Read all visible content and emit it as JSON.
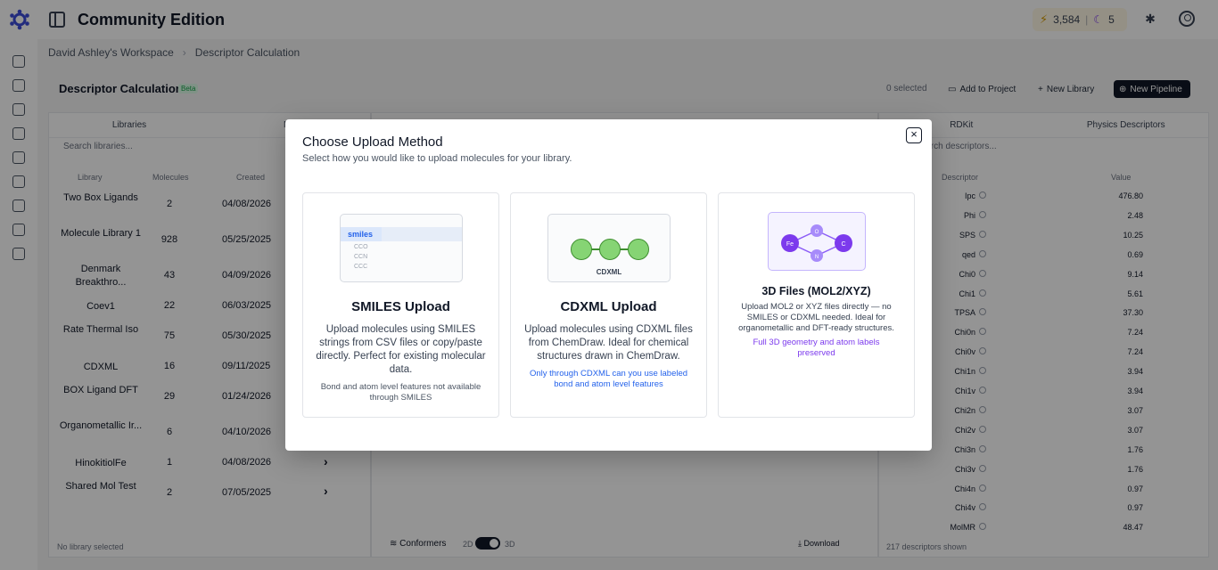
{
  "app": {
    "title": "Community Edition",
    "credits": "3,584",
    "separator": "|",
    "moon_count": "5"
  },
  "breadcrumb": {
    "workspace": "David Ashley's Workspace",
    "page": "Descriptor Calculation",
    "chevron": "›"
  },
  "header": {
    "title": "Descriptor Calculation",
    "badge": "Beta",
    "selected": "0 selected",
    "add_to_project": "Add to Project",
    "new_library": "New Library",
    "new_pipeline": "New Pipeline"
  },
  "left_panel": {
    "tab_libraries": "Libraries",
    "tab_molecules": "Mo",
    "search_placeholder": "Search libraries...",
    "columns": {
      "library": "Library",
      "molecules": "Molecules",
      "created": "Created"
    },
    "rows": [
      {
        "name": "Two Box Ligands",
        "count": "2",
        "date": "04/08/2026"
      },
      {
        "name": "Molecule Library 1",
        "count": "928",
        "date": "05/25/2025"
      },
      {
        "name": "Denmark Breakthro...",
        "count": "43",
        "date": "04/09/2026"
      },
      {
        "name": "Coev1",
        "count": "22",
        "date": "06/03/2025"
      },
      {
        "name": "Rate Thermal Iso",
        "count": "75",
        "date": "05/30/2025"
      },
      {
        "name": "CDXML",
        "count": "16",
        "date": "09/11/2025"
      },
      {
        "name": "BOX Ligand DFT",
        "count": "29",
        "date": "01/24/2026"
      },
      {
        "name": "Organometallic Ir...",
        "count": "6",
        "date": "04/10/2026"
      },
      {
        "name": "HinokitiolFe",
        "count": "1",
        "date": "04/08/2026",
        "arrow": "›"
      },
      {
        "name": "Shared Mol Test",
        "count": "2",
        "date": "07/05/2025",
        "arrow": "›"
      }
    ],
    "footer": "No library selected"
  },
  "middle_panel": {
    "conformers_label": "Conformers",
    "toggle_2d": "2D",
    "toggle_3d": "3D",
    "download_label": "Download"
  },
  "right_panel": {
    "tab_rdkit": "RDKit",
    "tab_physics": "Physics Descriptors",
    "search_placeholder": "Search descriptors...",
    "col_descriptor": "Descriptor",
    "col_value": "Value",
    "rows": [
      {
        "name": "Ipc",
        "value": "476.80"
      },
      {
        "name": "Phi",
        "value": "2.48"
      },
      {
        "name": "SPS",
        "value": "10.25"
      },
      {
        "name": "qed",
        "value": "0.69"
      },
      {
        "name": "Chi0",
        "value": "9.14"
      },
      {
        "name": "Chi1",
        "value": "5.61"
      },
      {
        "name": "TPSA",
        "value": "37.30"
      },
      {
        "name": "Chi0n",
        "value": "7.24"
      },
      {
        "name": "Chi0v",
        "value": "7.24"
      },
      {
        "name": "Chi1n",
        "value": "3.94"
      },
      {
        "name": "Chi1v",
        "value": "3.94"
      },
      {
        "name": "Chi2n",
        "value": "3.07"
      },
      {
        "name": "Chi2v",
        "value": "3.07"
      },
      {
        "name": "Chi3n",
        "value": "1.76"
      },
      {
        "name": "Chi3v",
        "value": "1.76"
      },
      {
        "name": "Chi4n",
        "value": "0.97"
      },
      {
        "name": "Chi4v",
        "value": "0.97"
      },
      {
        "name": "MolMR",
        "value": "48.47"
      }
    ],
    "footer": "217 descriptors shown"
  },
  "modal": {
    "title": "Choose Upload Method",
    "subtitle": "Select how you would like to upload molecules for your library.",
    "close_glyph": "×",
    "smiles": {
      "thumb_header": "smiles",
      "thumb_lines": [
        "CCO",
        "CCN",
        "CCC"
      ],
      "title": "SMILES Upload",
      "description": "Upload molecules using SMILES strings from CSV files or copy/paste directly. Perfect for existing molecular data.",
      "note": "Bond and atom level features not available through SMILES"
    },
    "cdxml": {
      "thumb_label": "CDXML",
      "title": "CDXML Upload",
      "description": "Upload molecules using CDXML files from ChemDraw. Ideal for chemical structures drawn in ChemDraw.",
      "note": "Only through CDXML can you use labeled bond and atom level features"
    },
    "threed": {
      "atoms": [
        "Fe",
        "O",
        "C",
        "N"
      ],
      "title": "3D Files (MOL2/XYZ)",
      "description": "Upload MOL2 or XYZ files directly — no SMILES or CDXML needed. Ideal for organometallic and DFT-ready structures.",
      "note": "Full 3D geometry and atom labels preserved"
    }
  },
  "colors": {
    "accent_blue": "#2563eb",
    "accent_purple": "#7c3aed",
    "accent_green": "#3f8f30",
    "dark_button": "#111827"
  }
}
